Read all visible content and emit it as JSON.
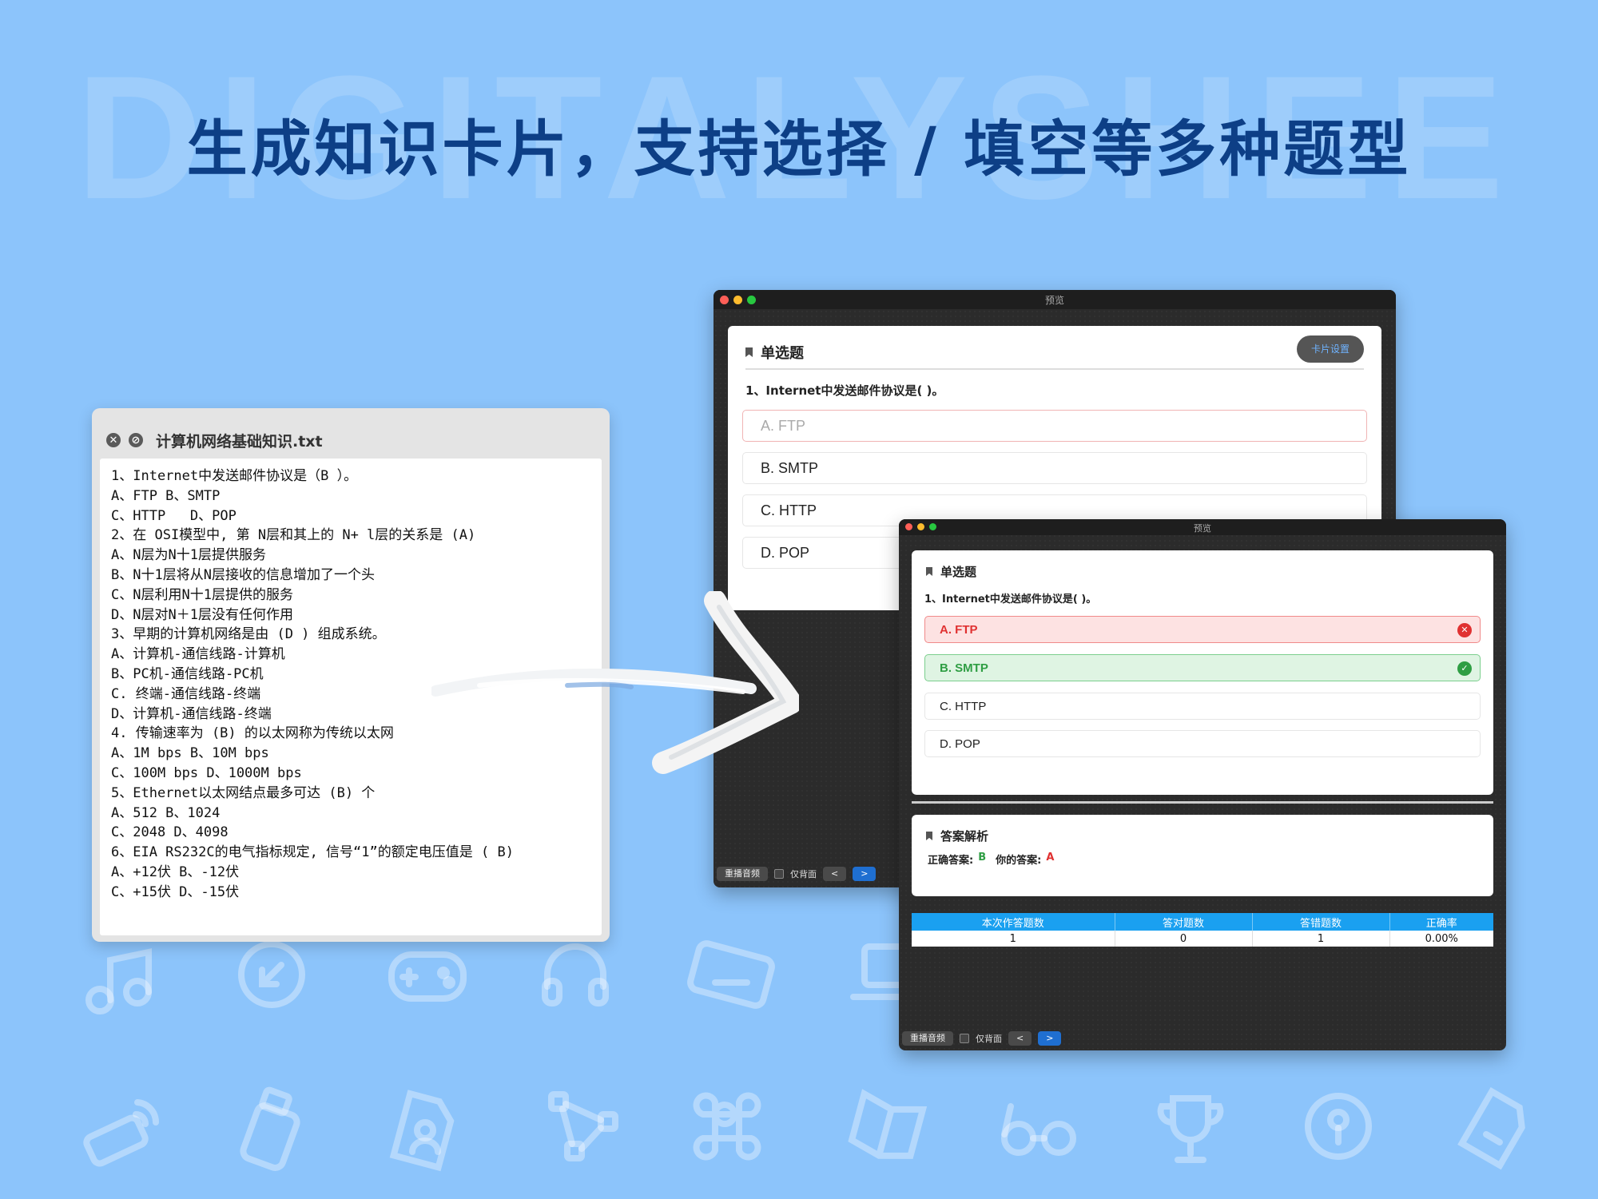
{
  "background_word": "DIGITALYSHEE",
  "headline": "生成知识卡片，支持选择 / 填空等多种题型",
  "text_file": {
    "filename": "计算机网络基础知识.txt",
    "lines": [
      "1、Internet中发送邮件协议是（B ）。",
      "A、FTP B、SMTP",
      "C、HTTP   D、POP",
      "2、在 OSI模型中, 第 N层和其上的 N+ l层的关系是 (A)",
      "A、N层为N十1层提供服务",
      "B、N十1层将从N层接收的信息增加了一个头",
      "C、N层利用N十1层提供的服务",
      "D、N层对N＋1层没有任何作用",
      "3、早期的计算机网络是由 (D ) 组成系统。",
      "A、计算机-通信线路-计算机",
      "B、PC机-通信线路-PC机",
      "C. 终端-通信线路-终端",
      "D、计算机-通信线路-终端",
      "4. 传输速率为 (B) 的以太网称为传统以太网",
      "A、1M bps B、10M bps",
      "C、100M bps D、1000M bps",
      "5、Ethernet以太网结点最多可达 (B) 个",
      "A、512 B、1024",
      "C、2048 D、4098",
      "6、EIA RS232C的电气指标规定, 信号“1”的额定电压值是 ( B)",
      "A、+12伏 B、-12伏",
      "C、+15伏 D、-15伏"
    ]
  },
  "preview_back": {
    "window_title": "预览",
    "question_type": "单选题",
    "settings_button": "卡片设置",
    "question": "1、Internet中发送邮件协议是( )。",
    "options": [
      "A. FTP",
      "B. SMTP",
      "C. HTTP",
      "D. POP"
    ],
    "controls": {
      "replay": "重播音频",
      "back_only": "仅背面",
      "prev": "<",
      "next": ">"
    }
  },
  "preview_front": {
    "window_title": "预览",
    "question_type": "单选题",
    "question": "1、Internet中发送邮件协议是( )。",
    "options": [
      "A. FTP",
      "B. SMTP",
      "C. HTTP",
      "D. POP"
    ],
    "wrong_option_index": 0,
    "correct_option_index": 1,
    "analysis": {
      "title": "答案解析",
      "correct_label": "正确答案:",
      "correct_value": "B",
      "yours_label": "你的答案:",
      "yours_value": "A"
    },
    "stats": {
      "headers": [
        "本次作答题数",
        "答对题数",
        "答错题数",
        "正确率"
      ],
      "values": [
        "1",
        "0",
        "1",
        "0.00%"
      ]
    },
    "controls": {
      "replay": "重播音频",
      "back_only": "仅背面",
      "prev": "<",
      "next": ">"
    }
  },
  "colors": {
    "background": "#8cc4fb",
    "headline": "#0d3f86",
    "wrong": "#e03131",
    "correct": "#2f9e44",
    "table_header": "#1aa0f0",
    "nav_blue": "#1f6fd1"
  },
  "background_icons": [
    "music-icon",
    "download-circle-icon",
    "gamepad-icon",
    "headphones-icon",
    "keyboard-icon",
    "laptop-icon",
    "router-icon",
    "usb-drive-icon",
    "file-person-icon",
    "vector-pen-icon",
    "command-icon",
    "book-icon",
    "glasses-icon",
    "trophy-icon",
    "lock-circle-icon",
    "tag-icon"
  ]
}
